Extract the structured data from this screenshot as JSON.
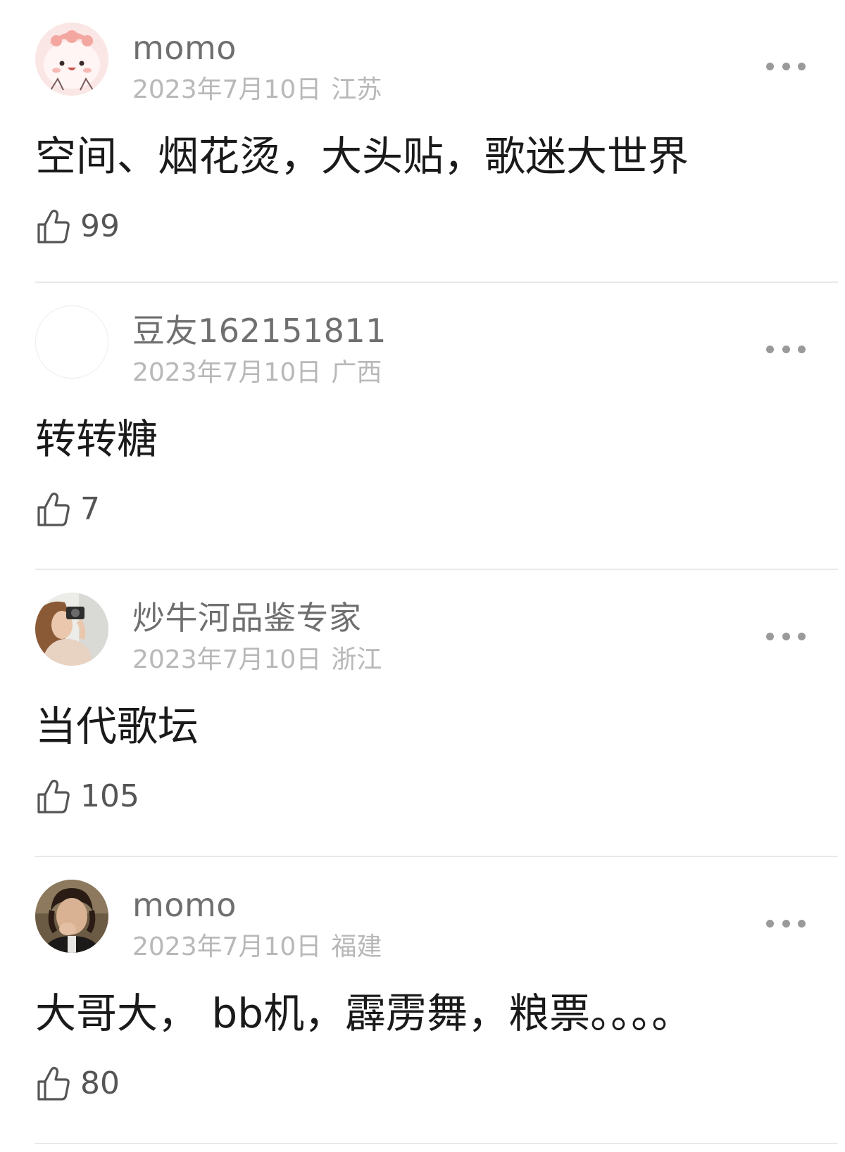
{
  "comments": [
    {
      "username": "momo",
      "date": "2023年7月10日",
      "location": "江苏",
      "text": "空间、烟花烫，大头贴，歌迷大世界",
      "likes": "99",
      "avatar": "cartoon-pink-character-avatar"
    },
    {
      "username": "豆友162151811",
      "date": "2023年7月10日",
      "location": "广西",
      "text": "转转糖",
      "likes": "7",
      "avatar": "blank-avatar"
    },
    {
      "username": "炒牛河品鉴专家",
      "date": "2023年7月10日",
      "location": "浙江",
      "text": "当代歌坛",
      "likes": "105",
      "avatar": "photo-woman-with-camera-avatar"
    },
    {
      "username": "momo",
      "date": "2023年7月10日",
      "location": "福建",
      "text": "大哥大， bb机，霹雳舞，粮票。。。。",
      "likes": "80",
      "avatar": "photo-man-laughing-avatar"
    }
  ],
  "icons": {
    "like": "thumbs-up-icon",
    "more": "more-options-icon"
  },
  "colors": {
    "username": "#6f6f6f",
    "meta": "#b8b8b8",
    "text": "#1a1a1a",
    "divider": "#e9e9e9"
  }
}
